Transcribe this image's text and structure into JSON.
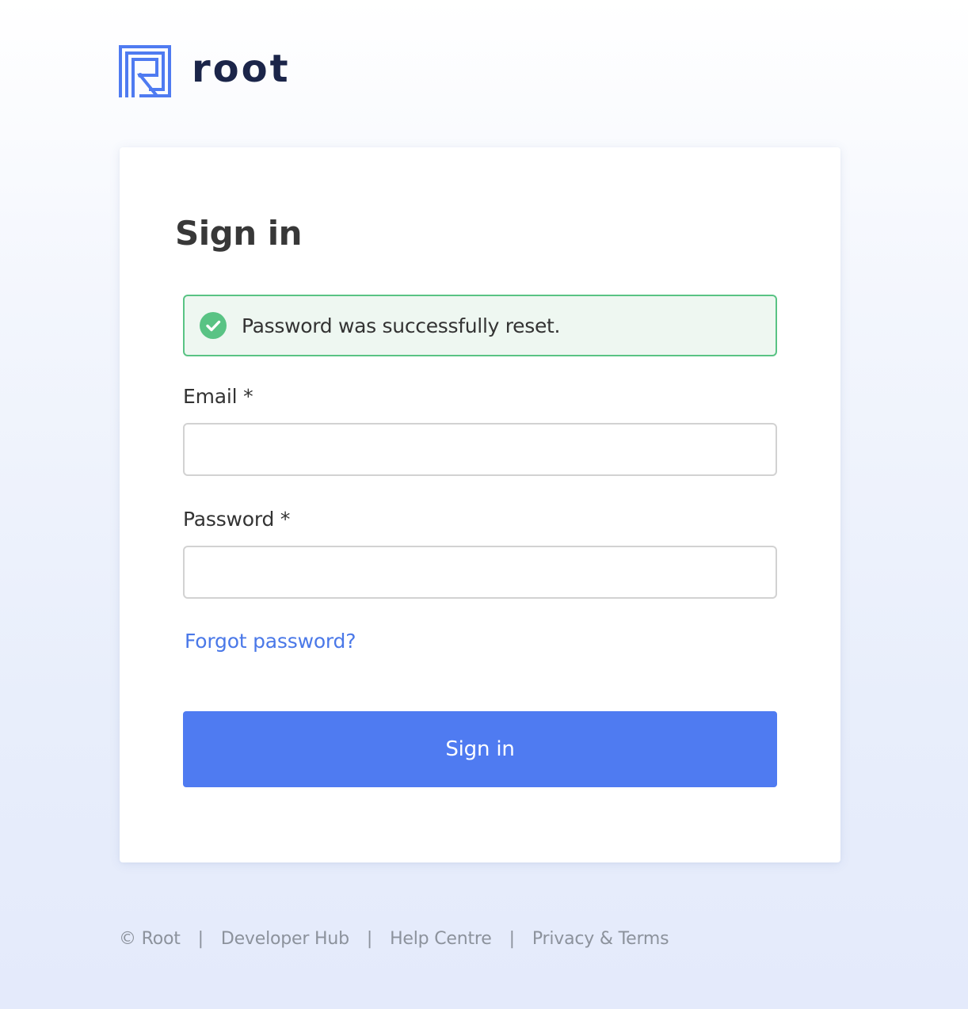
{
  "brand": {
    "name": "root",
    "logo_icon": "root-r-logo-icon",
    "logo_color": "#4f7bf1",
    "wordmark_color": "#1b2549"
  },
  "signin": {
    "title": "Sign in",
    "alert": {
      "icon": "check-circle-icon",
      "message": "Password was successfully reset.",
      "color": "#59c384"
    },
    "email": {
      "label": "Email *",
      "value": "",
      "placeholder": ""
    },
    "password": {
      "label": "Password *",
      "value": "",
      "placeholder": ""
    },
    "forgot_link": "Forgot password?",
    "submit_label": "Sign in",
    "accent_color": "#4f7bf1"
  },
  "footer": {
    "copyright": "© Root",
    "separator": "|",
    "links": [
      "Developer Hub",
      "Help Centre",
      "Privacy & Terms"
    ]
  }
}
